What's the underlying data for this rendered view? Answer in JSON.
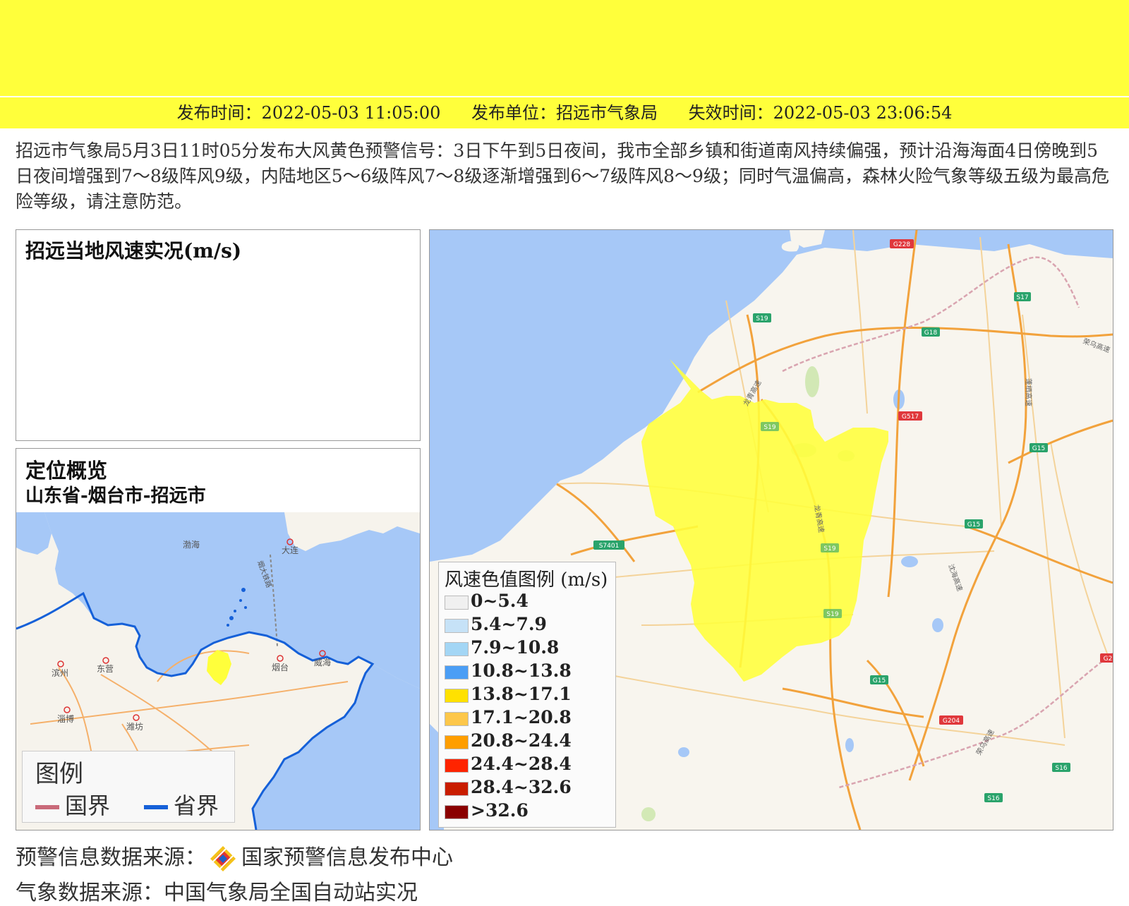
{
  "banner": {
    "color": "#ffff3b"
  },
  "info_bar": {
    "publish_time": "发布时间：2022-05-03 11:05:00",
    "publish_unit": "发布单位：招远市气象局",
    "expire_time": "失效时间：2022-05-03 23:06:54"
  },
  "description": "招远市气象局5月3日11时05分发布大风黄色预警信号：3日下午到5日夜间，我市全部乡镇和街道南风持续偏强，预计沿海海面4日傍晚到5日夜间增强到7～8级阵风9级，内陆地区5～6级阵风7～8级逐渐增强到6～7级阵风8～9级；同时气温偏高，森林火险气象等级五级为最高危险等级，请注意防范。",
  "wind_panel": {
    "title": "招远当地风速实况(m/s)"
  },
  "location_panel": {
    "title": "定位概览",
    "subtitle": "山东省-烟台市-招远市",
    "map_labels": {
      "bohai": "渤海",
      "dalian": "大连",
      "binzhou": "滨州",
      "dongying": "东营",
      "yantai": "烟台",
      "weihai": "威海",
      "zibo": "淄博",
      "weifang": "潍坊",
      "ferry": "烟大铁路"
    },
    "legend": {
      "title": "图例",
      "national_border": "国界",
      "provincial_border": "省界",
      "national_color": "#c96a7a",
      "provincial_color": "#1560d8"
    }
  },
  "main_map": {
    "sea_color": "#a6c8f7",
    "land_color": "#f8f5ee",
    "warning_area_color": "#ffff3b",
    "road_labels": [
      "G228",
      "S17",
      "S19",
      "G18",
      "G517",
      "S19",
      "G15",
      "G15",
      "S7401",
      "S19",
      "S19",
      "G15",
      "G204",
      "S16",
      "S16",
      "G2"
    ],
    "vertical_road_labels": [
      "龙青高速",
      "蓬栖高速",
      "沈海高速",
      "龙青高速",
      "荣乌高速",
      "荣乌高速"
    ]
  },
  "wind_legend": {
    "title": "风速色值图例 (m/s)",
    "items": [
      {
        "label": "0~5.4",
        "color": "#f0f0f0"
      },
      {
        "label": "5.4~7.9",
        "color": "#c6e2f7"
      },
      {
        "label": "7.9~10.8",
        "color": "#a3d6f5"
      },
      {
        "label": "10.8~13.8",
        "color": "#4b9ef5"
      },
      {
        "label": "13.8~17.1",
        "color": "#ffe100"
      },
      {
        "label": "17.1~20.8",
        "color": "#fdc74a"
      },
      {
        "label": "20.8~24.4",
        "color": "#ff9e00"
      },
      {
        "label": "24.4~28.4",
        "color": "#ff2400"
      },
      {
        "label": "28.4~32.6",
        "color": "#c91d00"
      },
      {
        "label": ">32.6",
        "color": "#8a0000"
      }
    ]
  },
  "sources": {
    "warning_source": "预警信息数据来源：",
    "warning_source_name": "国家预警信息发布中心",
    "weather_source": "气象数据来源：中国气象局全国自动站实况"
  }
}
